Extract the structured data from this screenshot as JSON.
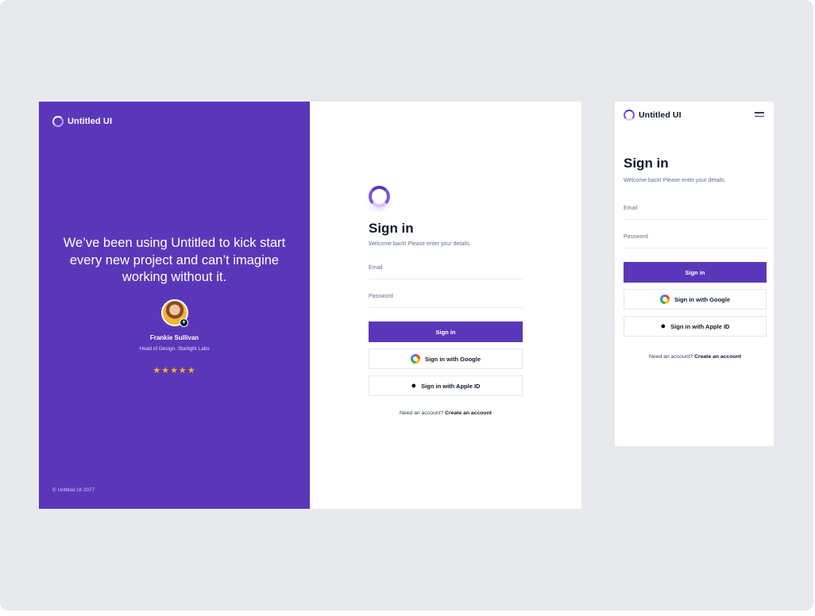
{
  "desktop": {
    "brand": "Untitled UI",
    "testimonial": {
      "quote": "We’ve been using Untitled to kick start every new project and can’t imagine working without it.",
      "name": "Frankie Sullivan",
      "role": "Head of Design, Starlight Labs",
      "rating": "★★★★★"
    },
    "copyright": "© Untitled UI 2077",
    "form": {
      "title": "Sign in",
      "subtitle": "Welcome back! Please enter your details.",
      "email_placeholder": "Email",
      "password_placeholder": "Password",
      "sign_in_label": "Sign in",
      "google_label": "Sign in with Google",
      "apple_label": "Sign in with Apple ID",
      "need_account": "Need an account?",
      "create_account": "Create an account"
    }
  },
  "mobile": {
    "brand": "Untitled UI",
    "form": {
      "title": "Sign in",
      "subtitle": "Welcome back! Please enter your details.",
      "email_placeholder": "Email",
      "password_placeholder": "Password",
      "sign_in_label": "Sign in",
      "google_label": "Sign in with Google",
      "apple_label": "Sign in with Apple ID",
      "need_account": "Need an account?",
      "create_account": "Create an account"
    }
  },
  "colors": {
    "brand_purple": "#5a37b9",
    "background": "#e8e9ed",
    "star": "#fdb022"
  },
  "icons": [
    "logo-ring-icon",
    "google-icon",
    "apple-icon",
    "menu-icon",
    "verified-badge-icon",
    "star-icon"
  ]
}
